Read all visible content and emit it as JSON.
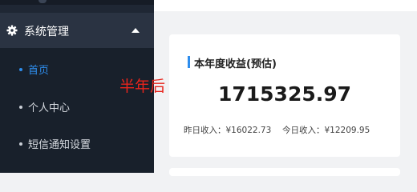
{
  "sidebar": {
    "group": {
      "icon": "gear-icon",
      "label": "系统管理",
      "caret_icon": "caret-up-icon"
    },
    "items": [
      {
        "label": "首页",
        "active": true
      },
      {
        "label": "个人中心",
        "active": false
      },
      {
        "label": "短信通知设置",
        "active": false
      }
    ]
  },
  "card": {
    "title": "本年度收益(预估)",
    "value": "1715325.97",
    "yesterday": "昨日收入：¥16022.73",
    "today": "今日收入：¥12209.95"
  },
  "annotation": {
    "text": "半年后",
    "color": "#e8241c"
  },
  "colors": {
    "accent": "#2e8ded",
    "sidebar_bg": "#1f2734"
  }
}
